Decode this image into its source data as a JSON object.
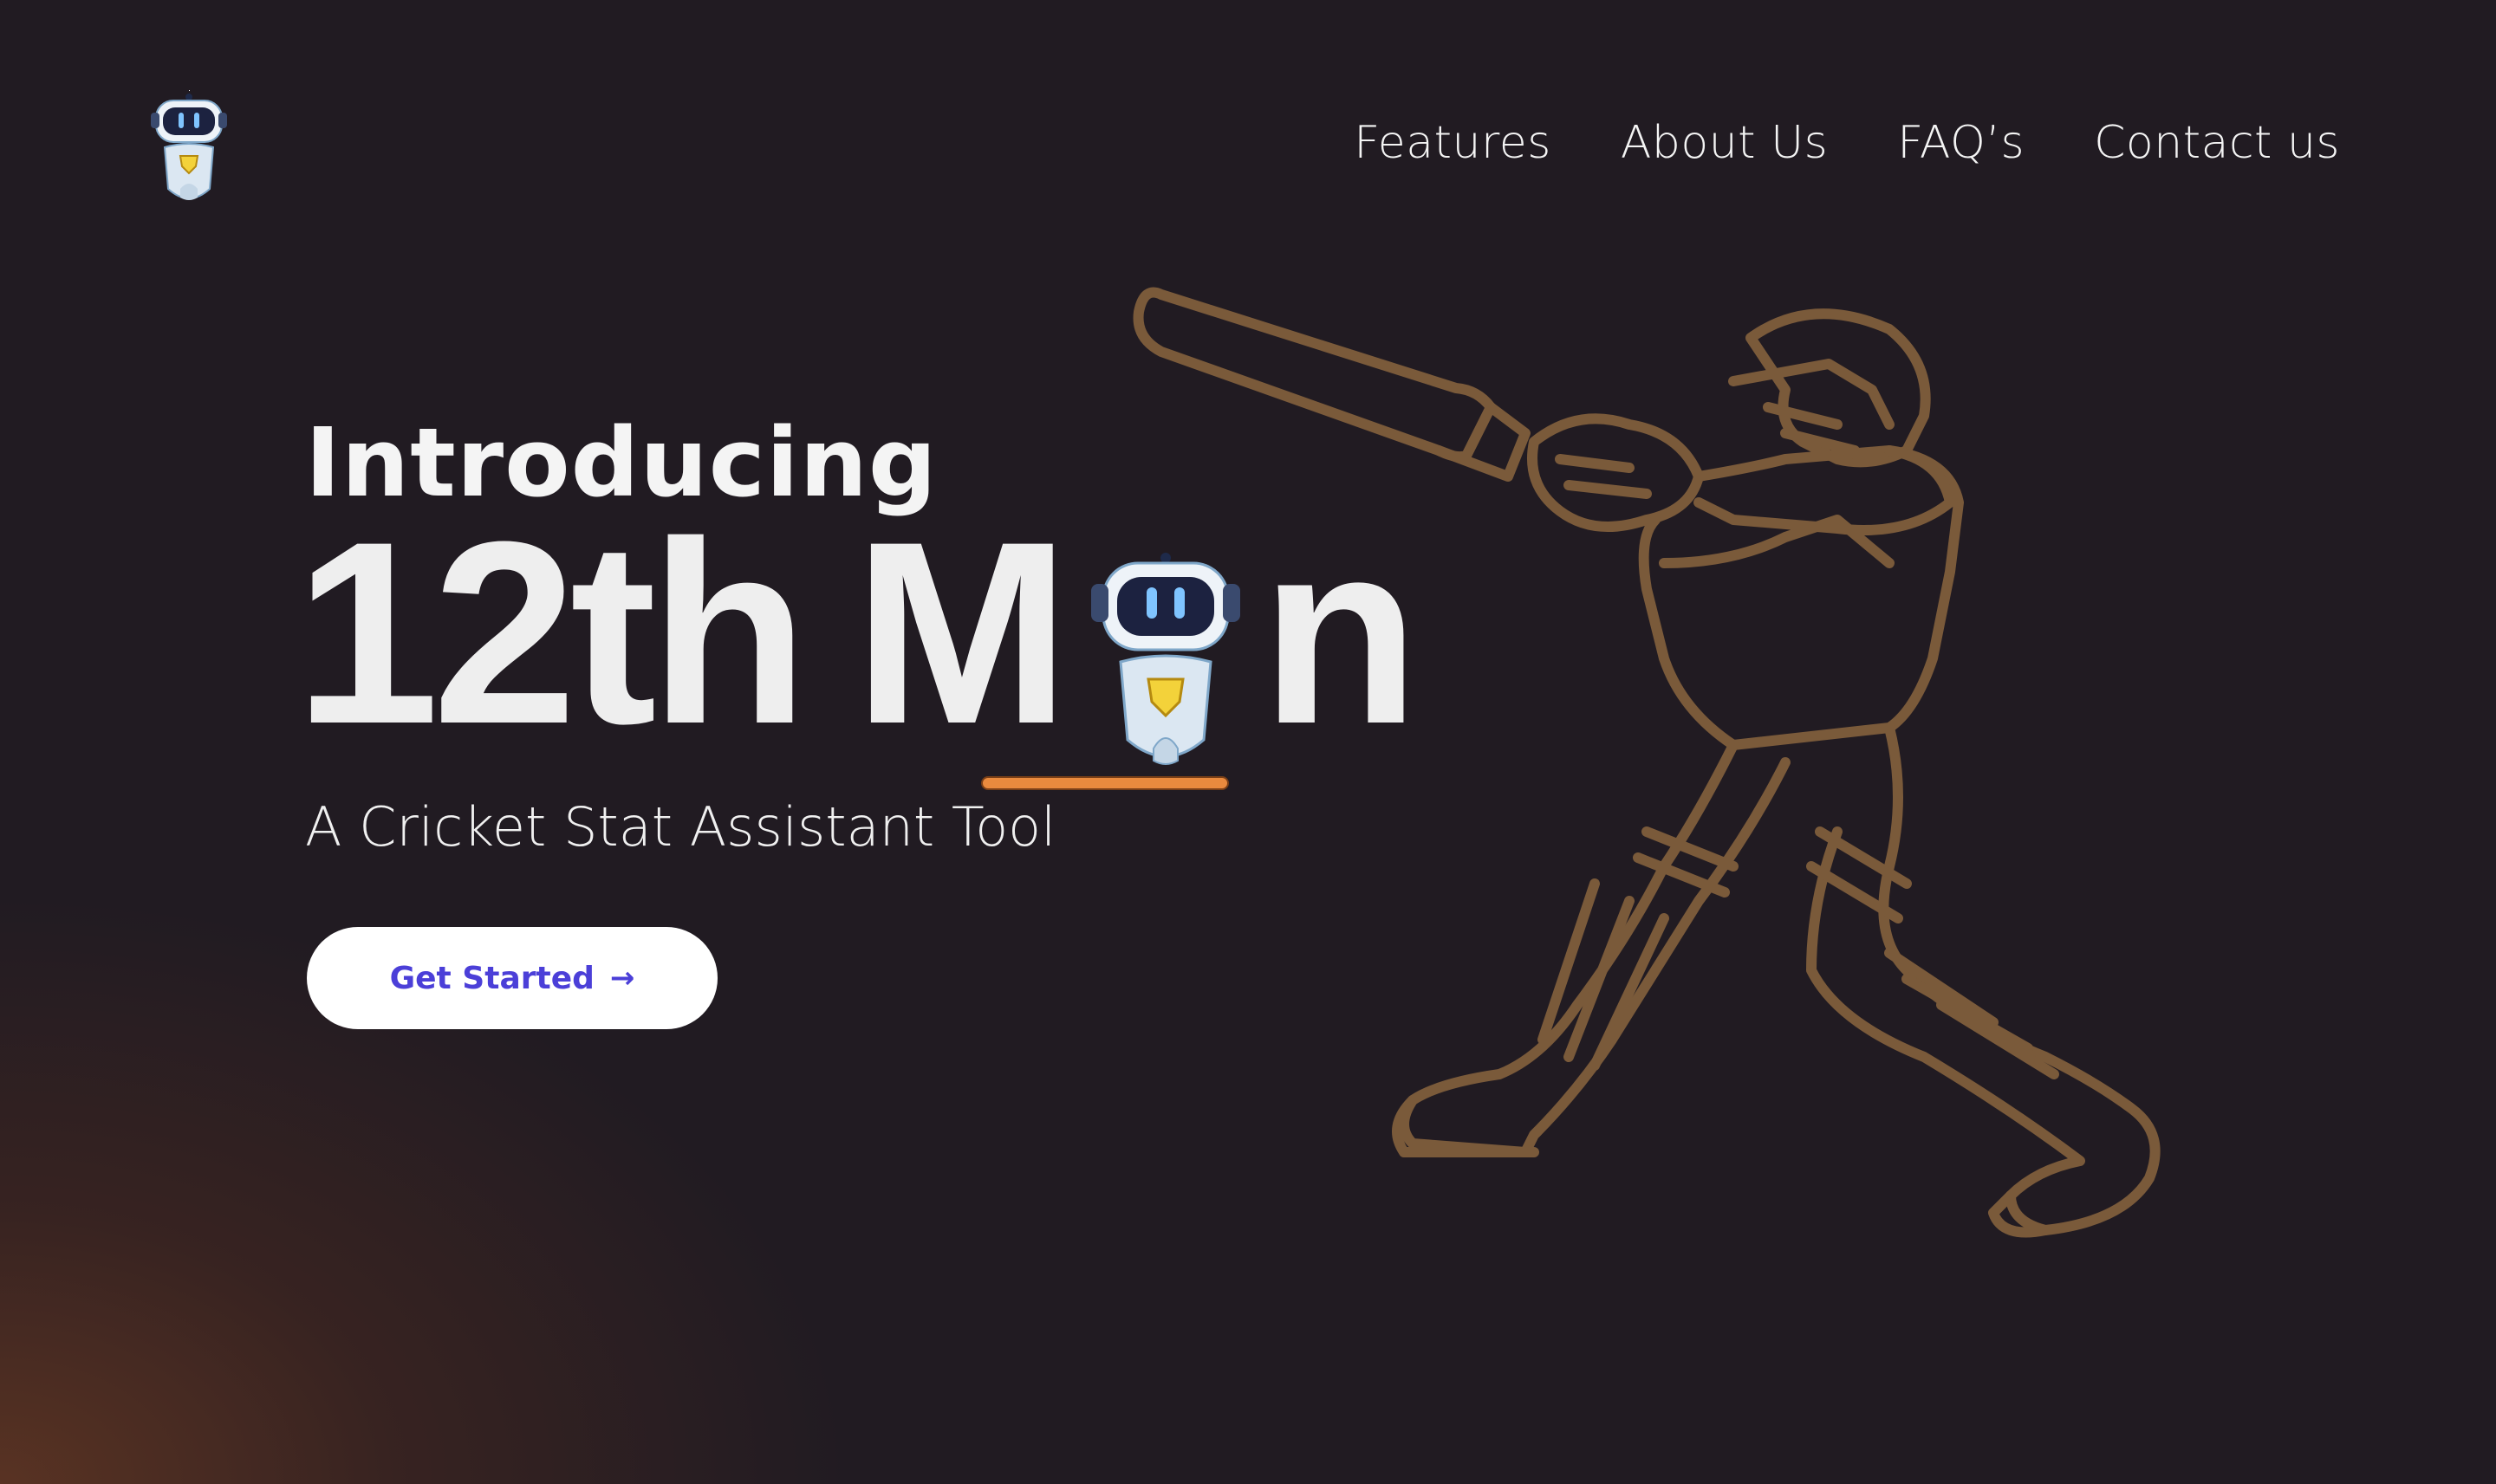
{
  "nav": {
    "items": [
      {
        "label": "Features"
      },
      {
        "label": "About Us"
      },
      {
        "label": "FAQ’s"
      },
      {
        "label": "Contact us"
      }
    ]
  },
  "hero": {
    "intro": "Introducing",
    "title_part1": "12th",
    "title_part2": "M",
    "title_part3": "n",
    "subtitle": "A Cricket Stat Assistant Tool",
    "cta_label": "Get Started",
    "cta_icon": "arrow-right-icon"
  },
  "colors": {
    "background": "#211b22",
    "accent_underline": "#e98a3e",
    "cta_text": "#4b3fd8",
    "illustration_stroke": "#7a5a3a"
  },
  "icons": {
    "logo": "robot-logo-icon",
    "title_letter": "robot-icon",
    "illustration": "cricket-batsman-illustration"
  }
}
